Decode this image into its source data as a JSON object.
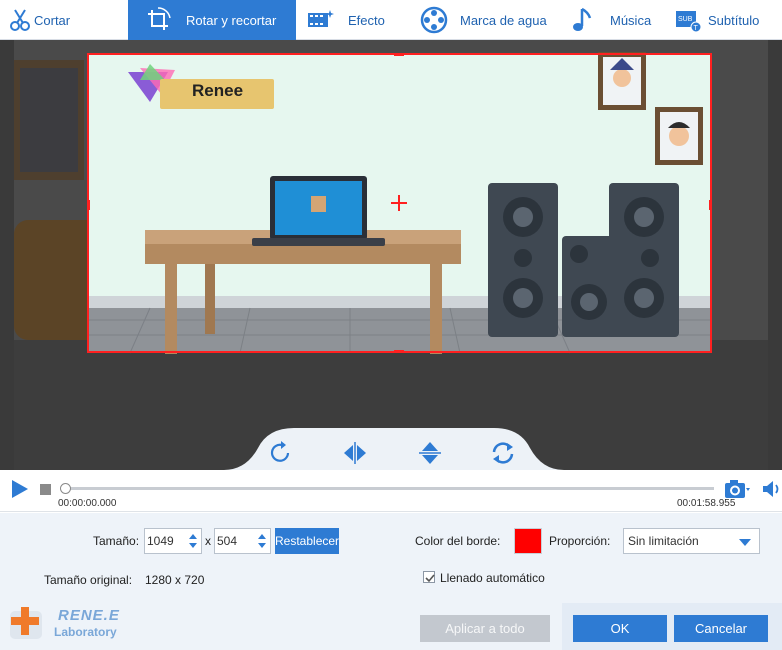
{
  "toolbar": {
    "items": [
      {
        "label": "Cortar",
        "icon": "scissors-icon"
      },
      {
        "label": "Rotar y recortar",
        "icon": "crop-icon",
        "active": true
      },
      {
        "label": "Efecto",
        "icon": "film-effect-icon"
      },
      {
        "label": "Marca de agua",
        "icon": "film-reel-icon"
      },
      {
        "label": "Música",
        "icon": "music-note-icon"
      },
      {
        "label": "Subtítulo",
        "icon": "subtitle-icon"
      }
    ]
  },
  "preview": {
    "banner_text": "Renee"
  },
  "timeline": {
    "current_time": "00:00:00.000",
    "total_time": "00:01:58.955"
  },
  "settings": {
    "size_label": "Tamaño:",
    "width": "1049",
    "separator": "x",
    "height": "504",
    "reset_label": "Restablecer",
    "border_color_label": "Color del borde:",
    "border_color": "#ff0000",
    "ratio_label": "Proporción:",
    "ratio_value": "Sin limitación",
    "original_size_label": "Tamaño original:",
    "original_size_value": "1280 x 720",
    "autofill_label": "Llenado automático",
    "autofill_checked": true
  },
  "brand": {
    "name": "RENE.E",
    "sub": "Laboratory"
  },
  "buttons": {
    "apply_all": "Aplicar a todo",
    "ok": "OK",
    "cancel": "Cancelar"
  },
  "colors": {
    "accent": "#2e7bd3",
    "crop_border": "#ff2020"
  }
}
